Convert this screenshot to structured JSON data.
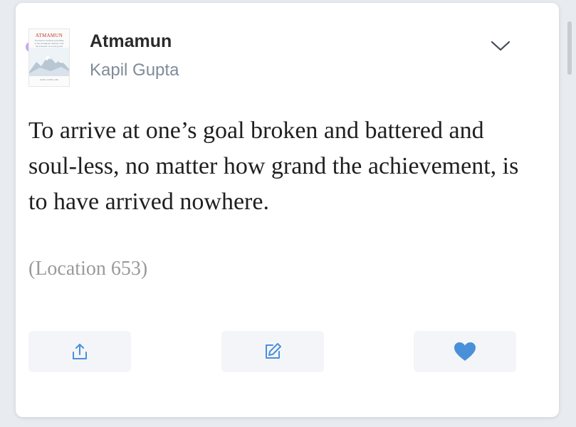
{
  "book": {
    "title": "Atmamun",
    "author": "Kapil Gupta",
    "cover_title": "ATMAMUN",
    "cover_subtitle": "The Path to Achieving the Bliss of the Himalayan Swamis. And the Freedom of a Living God",
    "cover_author": "KAPIL GUPTA, MD"
  },
  "highlight": {
    "text": "To arrive at one’s goal broken and battered and soul-less, no matter how grand the achievement, is to have arrived nowhere.",
    "location": "(Location 653)",
    "indicator_color": "#c9a8f0"
  },
  "icons": {
    "expand": "chevron-down-icon",
    "share": "share-icon",
    "edit": "edit-icon",
    "like": "heart-icon"
  },
  "colors": {
    "accent": "#4a90d9",
    "author_text": "#7f8b9a",
    "location_text": "#9a9a9a"
  }
}
